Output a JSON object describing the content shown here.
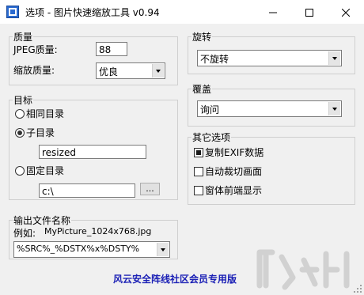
{
  "window": {
    "title": "选项 - 图片快速缩放工具 v0.94",
    "buttons": {
      "minimize": "—",
      "maximize": "☐",
      "close": "✕"
    }
  },
  "quality": {
    "legend": "质量",
    "jpeg_label": "JPEG质量:",
    "jpeg_value": "88",
    "scale_label": "缩放质量:",
    "scale_value": "优良"
  },
  "target": {
    "legend": "目标",
    "options": [
      {
        "label": "相同目录",
        "selected": false
      },
      {
        "label": "子目录",
        "selected": true
      },
      {
        "label": "固定目录",
        "selected": false
      }
    ],
    "subdir_value": "resized",
    "fixed_dir_value": "c:\\",
    "browse_label": "..."
  },
  "output": {
    "legend": "输出文件名称",
    "example_label": "例如:",
    "example_value": "MyPicture_1024x768.jpg",
    "pattern_value": "%SRC%_%DSTX%x%DSTY%"
  },
  "rotate": {
    "legend": "旋转",
    "value": "不旋转"
  },
  "overwrite": {
    "legend": "覆盖",
    "value": "询问"
  },
  "other": {
    "legend": "其它选项",
    "options": [
      {
        "label": "复制EXIF数据",
        "checked": true
      },
      {
        "label": "自动裁切画面",
        "checked": false
      },
      {
        "label": "窗体前端显示",
        "checked": false
      }
    ]
  },
  "footer": {
    "text": "风云安全阵线社区会员专用版"
  },
  "colors": {
    "footer_text": "#1a1fb5",
    "window_bg": "#f0f0f0",
    "titlebar_bg": "#ffffff"
  }
}
